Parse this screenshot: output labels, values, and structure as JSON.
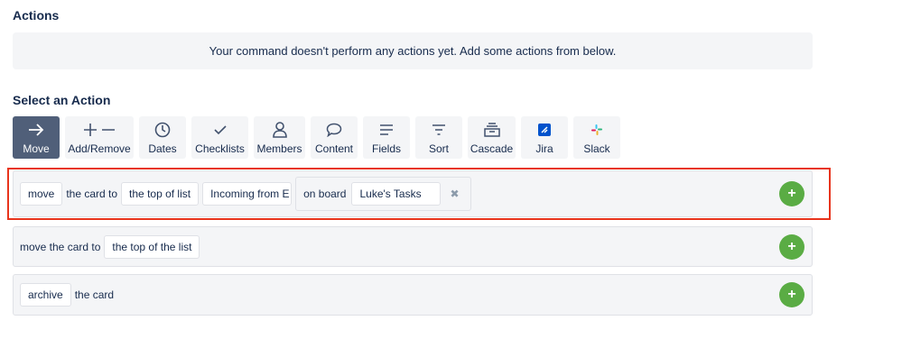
{
  "actions": {
    "title": "Actions",
    "empty_message": "Your command doesn't perform any actions yet. Add some actions from below."
  },
  "select": {
    "title": "Select an Action",
    "tools": [
      {
        "label": "Move",
        "icon": "arrow-right-icon",
        "active": true
      },
      {
        "label": "Add/Remove",
        "icon": "plus-minus-icon"
      },
      {
        "label": "Dates",
        "icon": "clock-icon"
      },
      {
        "label": "Checklists",
        "icon": "checkmark-icon"
      },
      {
        "label": "Members",
        "icon": "person-icon"
      },
      {
        "label": "Content",
        "icon": "speech-bubble-icon"
      },
      {
        "label": "Fields",
        "icon": "lines-icon"
      },
      {
        "label": "Sort",
        "icon": "sort-icon"
      },
      {
        "label": "Cascade",
        "icon": "archive-box-icon"
      },
      {
        "label": "Jira",
        "icon": "jira-icon"
      },
      {
        "label": "Slack",
        "icon": "slack-icon"
      }
    ]
  },
  "rows": {
    "move_to_list": {
      "verb": "move",
      "text1": "the card to",
      "position": "the top of list",
      "list": "Incoming from E",
      "on_board": "on board",
      "board": "Luke's Tasks",
      "remove_glyph": "✖",
      "add_glyph": "+"
    },
    "move_top": {
      "text": "move the card to",
      "position": "the top of the list",
      "add_glyph": "+"
    },
    "archive": {
      "verb": "archive",
      "text": "the card",
      "add_glyph": "+"
    }
  },
  "colors": {
    "accent_green": "#5aac44",
    "highlight_red": "#e8341c",
    "active_tool": "#505f79",
    "jira_blue": "#0052cc"
  }
}
